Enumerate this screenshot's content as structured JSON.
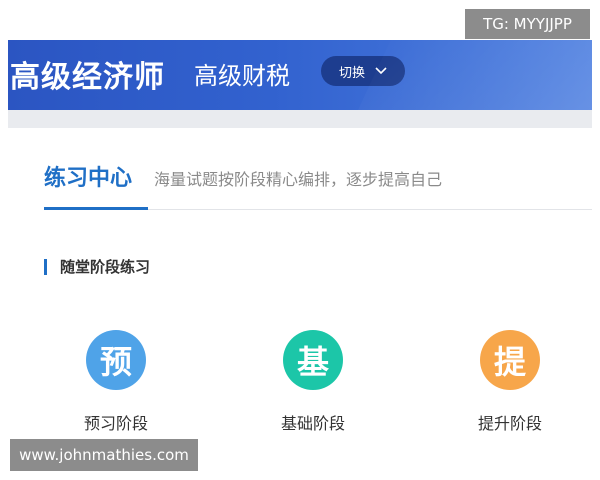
{
  "header": {
    "title": "高级经济师",
    "subtitle": "高级财税",
    "switch_label": "切换",
    "switch_icon": "chevron-down-icon"
  },
  "tabs": {
    "active_label": "练习中心",
    "description": "海量试题按阶段精心编排，逐步提高自己"
  },
  "section": {
    "title": "随堂阶段练习"
  },
  "stages": [
    {
      "glyph": "预",
      "label": "预习阶段",
      "color": "#4fa3e8"
    },
    {
      "glyph": "基",
      "label": "基础阶段",
      "color": "#1cc6a8"
    },
    {
      "glyph": "提",
      "label": "提升阶段",
      "color": "#f7a64a"
    }
  ],
  "watermarks": {
    "top": "TG: MYYJJPP",
    "bottom": "www.johnmathies.com"
  }
}
